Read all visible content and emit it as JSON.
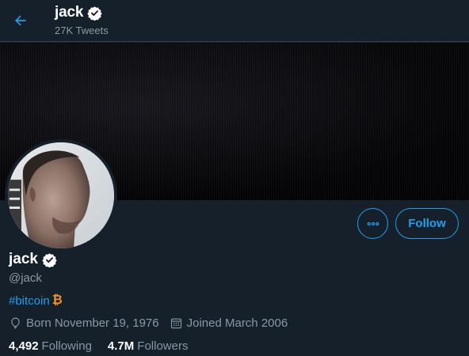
{
  "header": {
    "title": "jack",
    "subtitle": "27K Tweets"
  },
  "profile": {
    "name": "jack",
    "handle": "@jack",
    "bio_hashtag": "#bitcoin",
    "bio_symbol": "₿",
    "born": "Born November 19, 1976",
    "joined": "Joined March 2006",
    "following_count": "4,492",
    "following_label": "Following",
    "followers_count": "4.7M",
    "followers_label": "Followers"
  },
  "actions": {
    "follow_label": "Follow"
  },
  "icons": {
    "back": "arrow-left-icon",
    "verified": "verified-badge-icon",
    "more": "more-dots-icon",
    "birthday": "balloon-icon",
    "joined": "calendar-icon"
  },
  "colors": {
    "background": "#15202b",
    "accent": "#1da1f2",
    "muted_text": "#8899a6",
    "bitcoin": "#f7931a",
    "banner": "#050507"
  }
}
